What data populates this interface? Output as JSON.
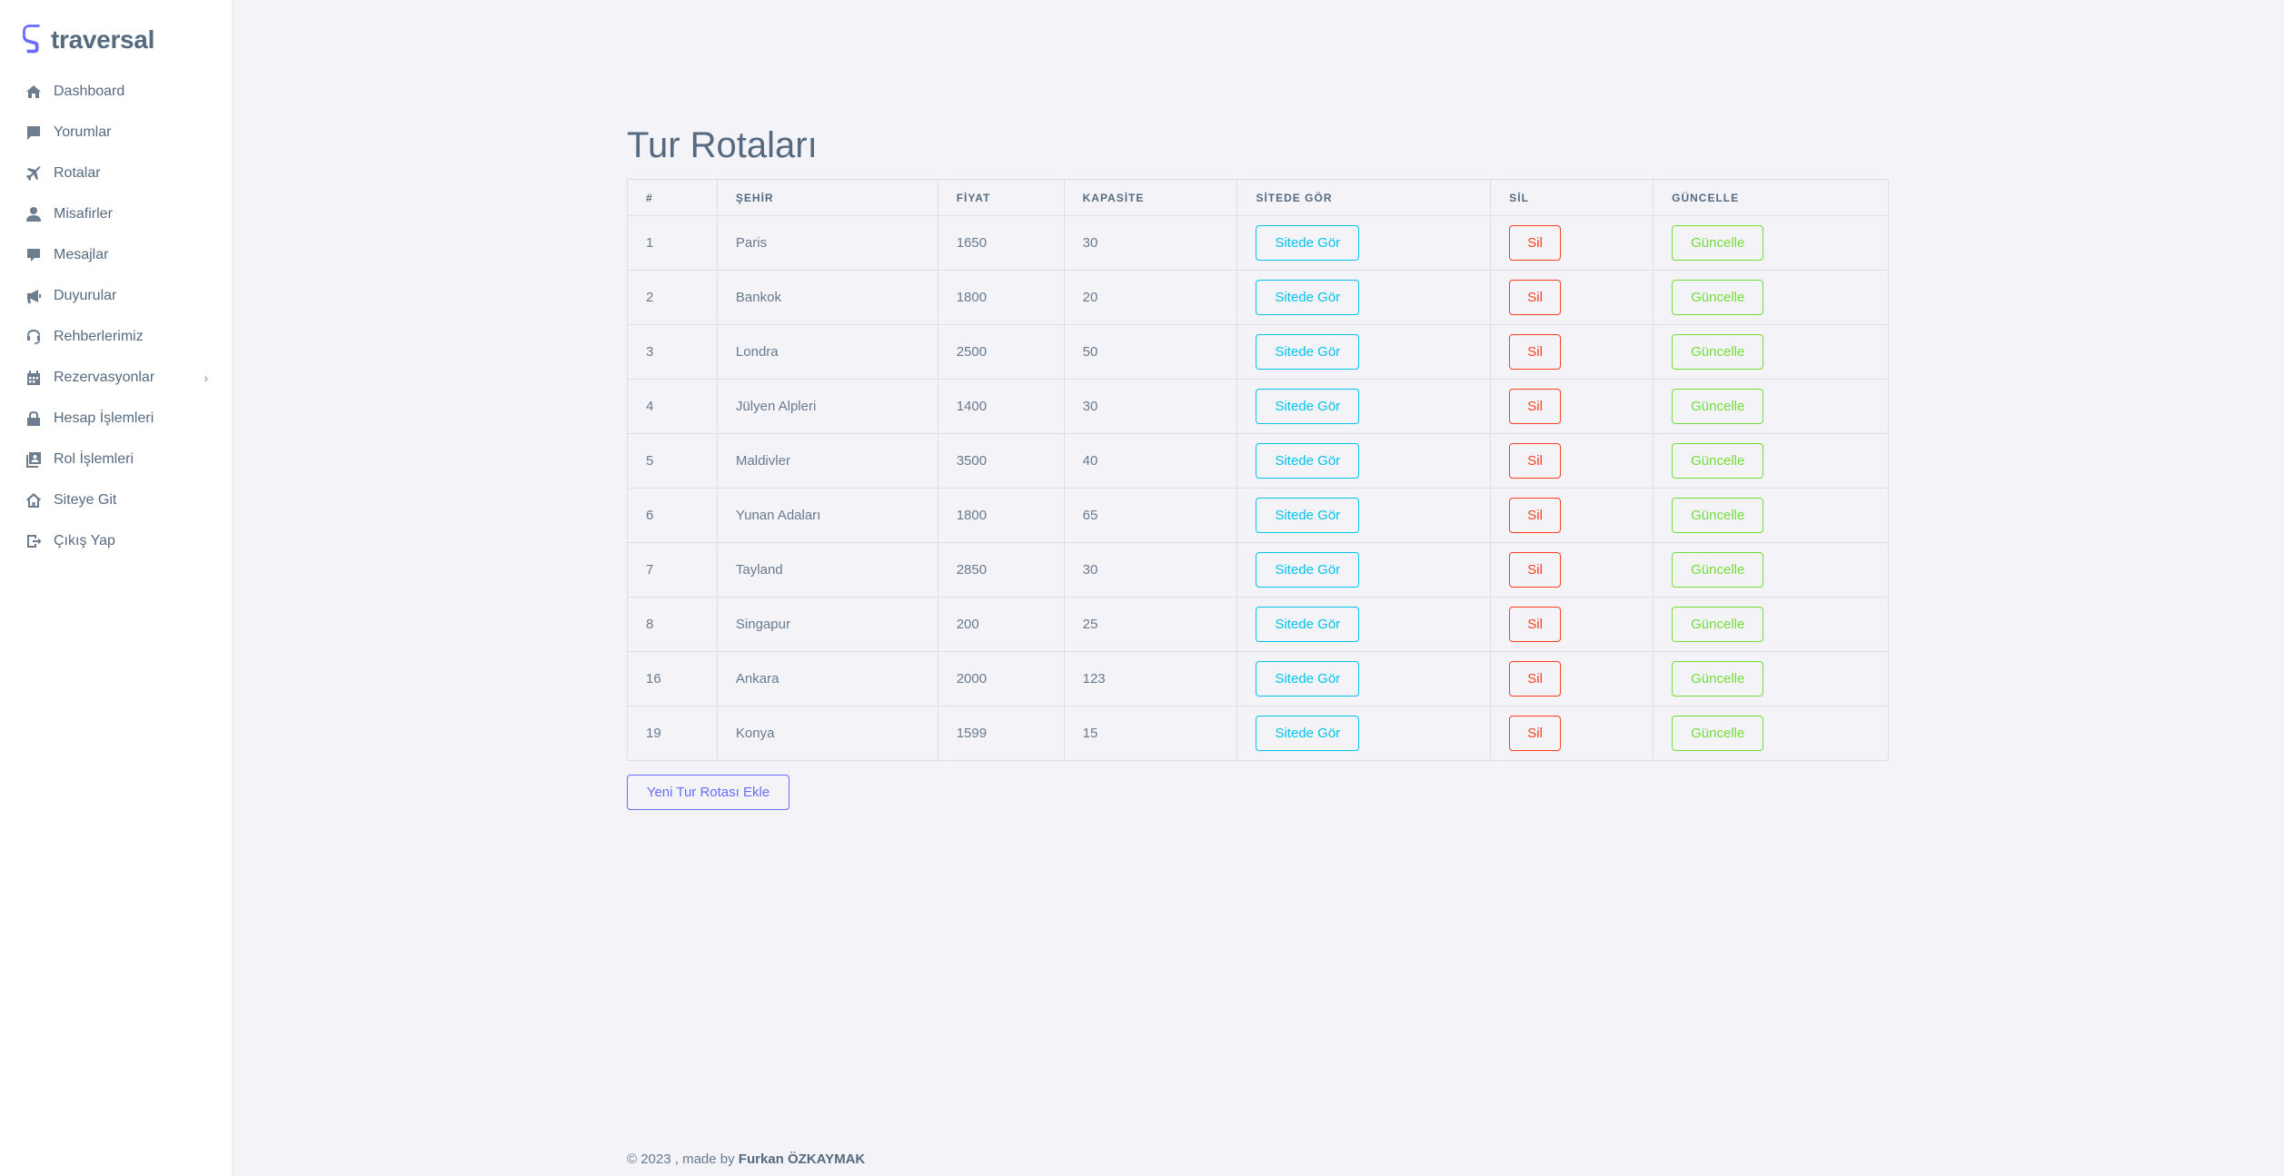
{
  "brand": {
    "name": "traversal",
    "color": "#696cff"
  },
  "sidebar": {
    "items": [
      {
        "label": "Dashboard",
        "icon": "home-icon"
      },
      {
        "label": "Yorumlar",
        "icon": "comment-icon"
      },
      {
        "label": "Rotalar",
        "icon": "plane-icon"
      },
      {
        "label": "Misafirler",
        "icon": "user-icon"
      },
      {
        "label": "Mesajlar",
        "icon": "message-icon"
      },
      {
        "label": "Duyurular",
        "icon": "megaphone-icon"
      },
      {
        "label": "Rehberlerimiz",
        "icon": "headset-icon"
      },
      {
        "label": "Rezervasyonlar",
        "icon": "calendar-icon",
        "submenu": true
      },
      {
        "label": "Hesap İşlemleri",
        "icon": "lock-icon"
      },
      {
        "label": "Rol İşlemleri",
        "icon": "roles-icon"
      },
      {
        "label": "Siteye Git",
        "icon": "house-outline-icon"
      },
      {
        "label": "Çıkış Yap",
        "icon": "logout-icon"
      }
    ]
  },
  "main": {
    "title": "Tur Rotaları",
    "columns": [
      "#",
      "ŞEHİR",
      "FİYAT",
      "KAPASİTE",
      "SİTEDE GÖR",
      "SİL",
      "GÜNCELLE"
    ],
    "rows": [
      {
        "id": "1",
        "city": "Paris",
        "price": "1650",
        "capacity": "30"
      },
      {
        "id": "2",
        "city": "Bankok",
        "price": "1800",
        "capacity": "20"
      },
      {
        "id": "3",
        "city": "Londra",
        "price": "2500",
        "capacity": "50"
      },
      {
        "id": "4",
        "city": "Jülyen Alpleri",
        "price": "1400",
        "capacity": "30"
      },
      {
        "id": "5",
        "city": "Maldivler",
        "price": "3500",
        "capacity": "40"
      },
      {
        "id": "6",
        "city": "Yunan Adaları",
        "price": "1800",
        "capacity": "65"
      },
      {
        "id": "7",
        "city": "Tayland",
        "price": "2850",
        "capacity": "30"
      },
      {
        "id": "8",
        "city": "Singapur",
        "price": "200",
        "capacity": "25"
      },
      {
        "id": "16",
        "city": "Ankara",
        "price": "2000",
        "capacity": "123"
      },
      {
        "id": "19",
        "city": "Konya",
        "price": "1599",
        "capacity": "15"
      }
    ],
    "buttons": {
      "view": "Sitede Gör",
      "delete": "Sil",
      "update": "Güncelle"
    },
    "add_button": "Yeni Tur Rotası Ekle"
  },
  "footer": {
    "prefix": "© 2023 , made by ",
    "author": "Furkan ÖZKAYMAK"
  },
  "colors": {
    "info": "#03c3ec",
    "danger": "#ff3e1d",
    "success": "#71dd37",
    "primary": "#696cff"
  }
}
